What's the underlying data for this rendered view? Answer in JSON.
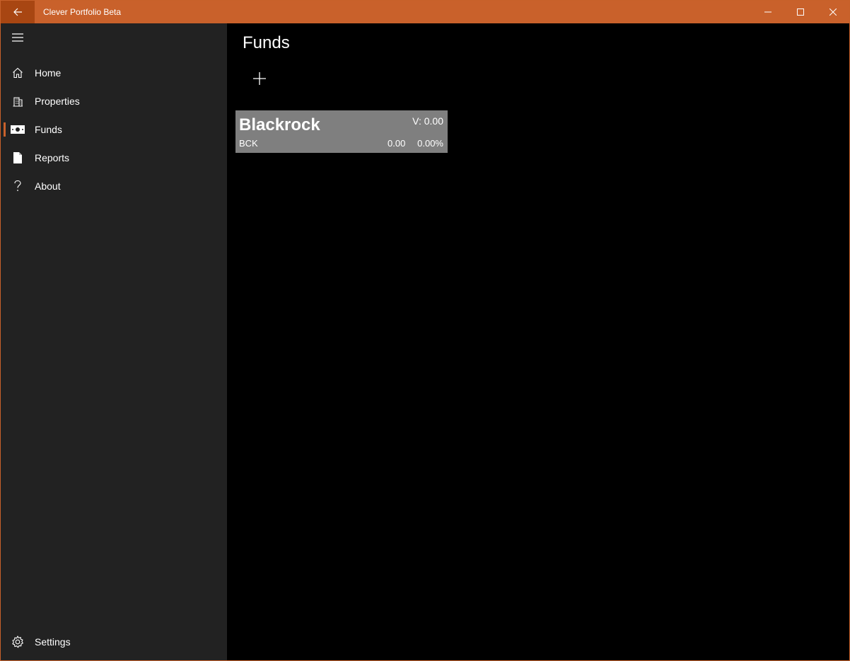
{
  "app": {
    "title": "Clever Portfolio Beta",
    "accent_color": "#c9612b"
  },
  "titlebar": {
    "back_icon": "arrow-left-icon",
    "controls": [
      "minimize-icon",
      "maximize-icon",
      "close-icon"
    ]
  },
  "sidebar": {
    "menu_icon": "hamburger-icon",
    "items": [
      {
        "label": "Home",
        "icon": "home-icon",
        "selected": false
      },
      {
        "label": "Properties",
        "icon": "building-icon",
        "selected": false
      },
      {
        "label": "Funds",
        "icon": "money-icon",
        "selected": true
      },
      {
        "label": "Reports",
        "icon": "document-icon",
        "selected": false
      },
      {
        "label": "About",
        "icon": "question-icon",
        "selected": false
      }
    ],
    "footer": {
      "label": "Settings",
      "icon": "gear-icon"
    }
  },
  "main": {
    "page_title": "Funds",
    "add_icon": "plus-icon",
    "funds": [
      {
        "name": "Blackrock",
        "value": "V: 0.00",
        "code": "BCK",
        "change": "0.00",
        "change_percent": "0.00%"
      }
    ]
  }
}
